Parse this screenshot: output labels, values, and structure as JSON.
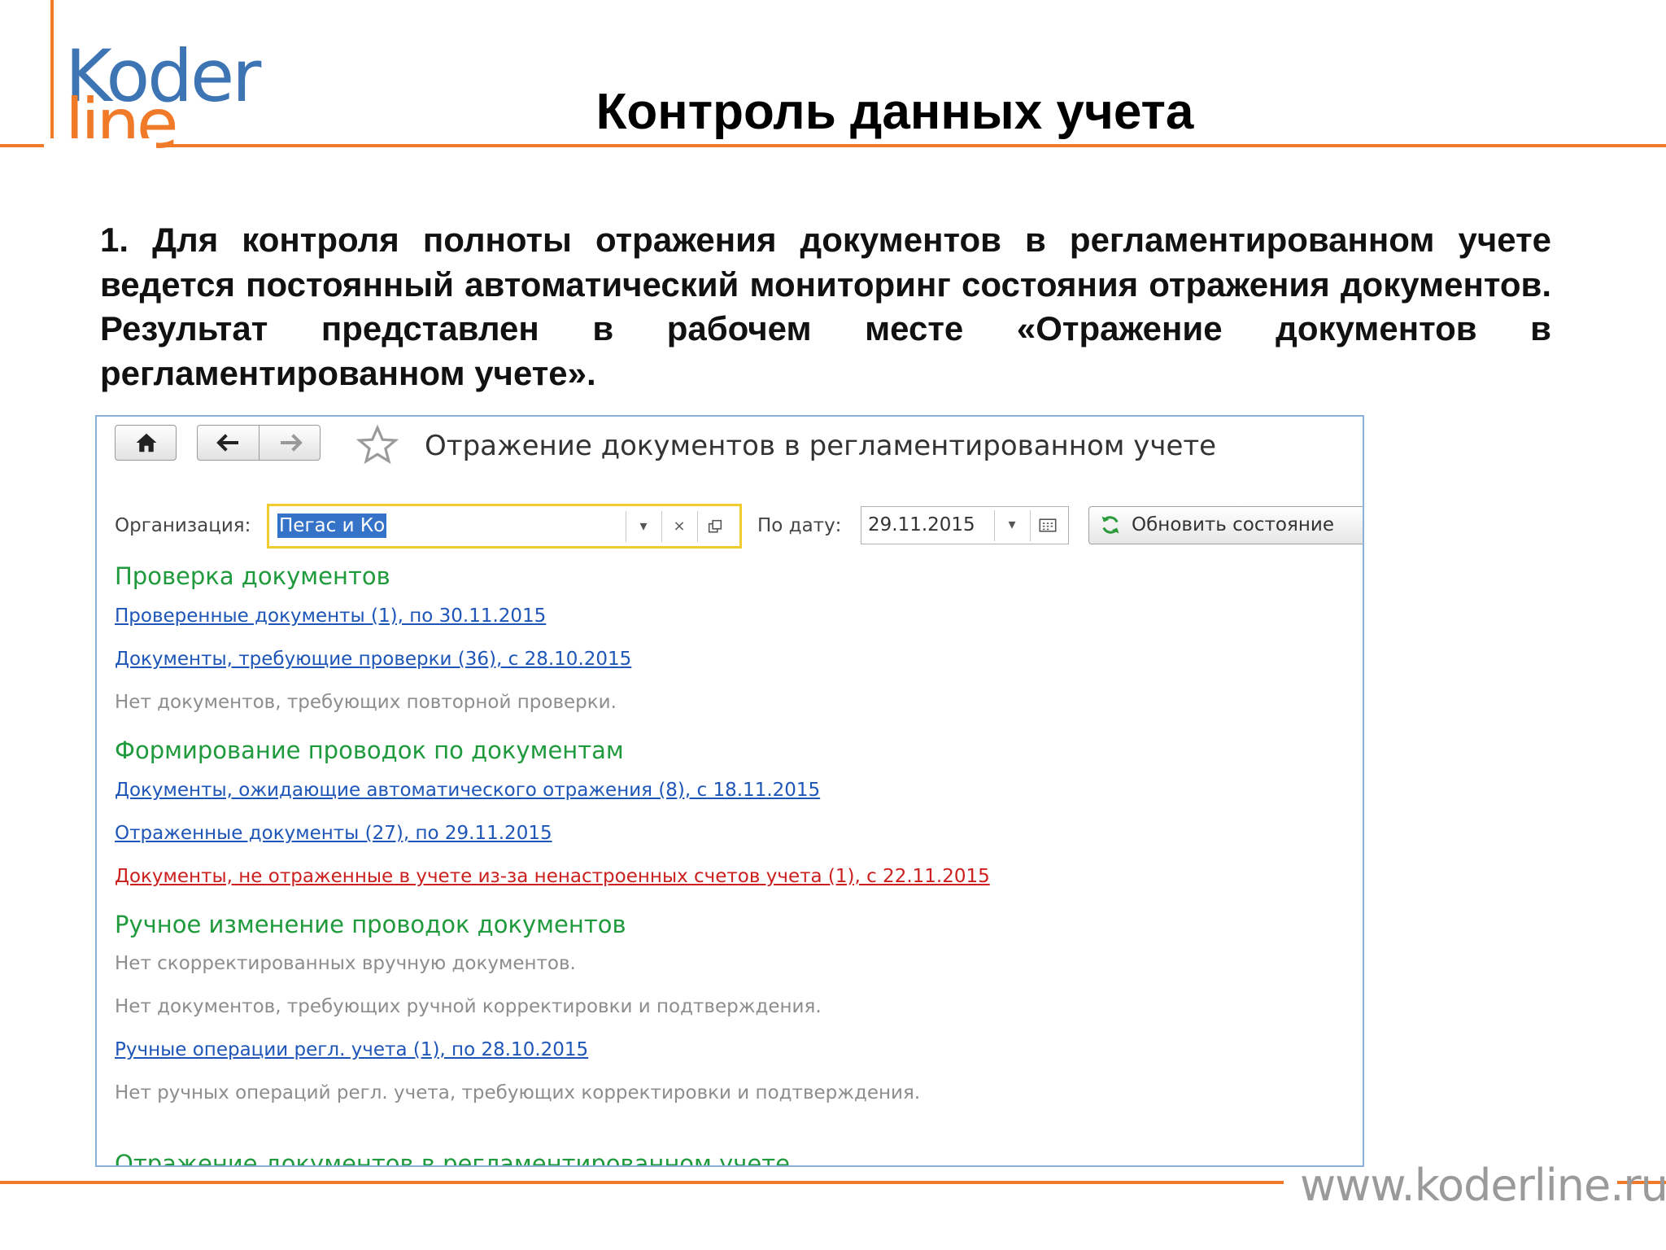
{
  "logo": {
    "line1": "Koder",
    "line2": "line",
    "brand_orange": "#f07a28",
    "brand_blue": "#3c74b4"
  },
  "slide": {
    "title": "Контроль данных учета",
    "intro": "1. Для контроля полноты отражения документов в регламентированном учете ведется постоянный автоматический мониторинг состояния отражения документов. Результат представлен в рабочем месте «Отражение документов в регламентированном учете».",
    "footer_url": "www.koderline.ru"
  },
  "window": {
    "title": "Отражение документов в регламентированном учете",
    "icons": {
      "home": "home-icon",
      "back": "arrow-left-icon",
      "forward": "arrow-right-icon",
      "favorite": "star-icon"
    }
  },
  "filters": {
    "org_label": "Организация:",
    "org_value": "Пегас и Ко",
    "date_label": "По дату:",
    "date_value": "29.11.2015",
    "refresh_label": "Обновить состояние",
    "accent": "#f2cc2c"
  },
  "sections": [
    {
      "heading": "Проверка документов",
      "items": [
        {
          "text": "Проверенные документы (1), по 30.11.2015",
          "kind": "link"
        },
        {
          "text": "Документы, требующие проверки (36), с 28.10.2015",
          "kind": "link"
        },
        {
          "text": "Нет документов, требующих повторной проверки.",
          "kind": "muted"
        }
      ]
    },
    {
      "heading": "Формирование проводок по документам",
      "items": [
        {
          "text": "Документы, ожидающие автоматического отражения (8), с 18.11.2015",
          "kind": "link"
        },
        {
          "text": "Отраженные документы (27), по 29.11.2015",
          "kind": "link"
        },
        {
          "text": "Документы, не отраженные в учете из-за ненастроенных счетов учета (1), с 22.11.2015",
          "kind": "warn"
        }
      ]
    },
    {
      "heading": "Ручное изменение проводок документов",
      "items": [
        {
          "text": "Нет скорректированных вручную документов.",
          "kind": "muted"
        },
        {
          "text": "Нет документов, требующих ручной корректировки и подтверждения.",
          "kind": "muted"
        },
        {
          "text": "Ручные операции регл. учета (1), по 28.10.2015",
          "kind": "link"
        },
        {
          "text": "Нет ручных операций регл. учета, требующих корректировки и подтверждения.",
          "kind": "muted"
        }
      ]
    }
  ],
  "cut_heading": "Отражение документов в регламентированном учете",
  "colors": {
    "heading_green": "#1f9a3c",
    "link_blue": "#1e56b8",
    "warn_red": "#cc1f1f",
    "muted_gray": "#8d8d8d"
  }
}
